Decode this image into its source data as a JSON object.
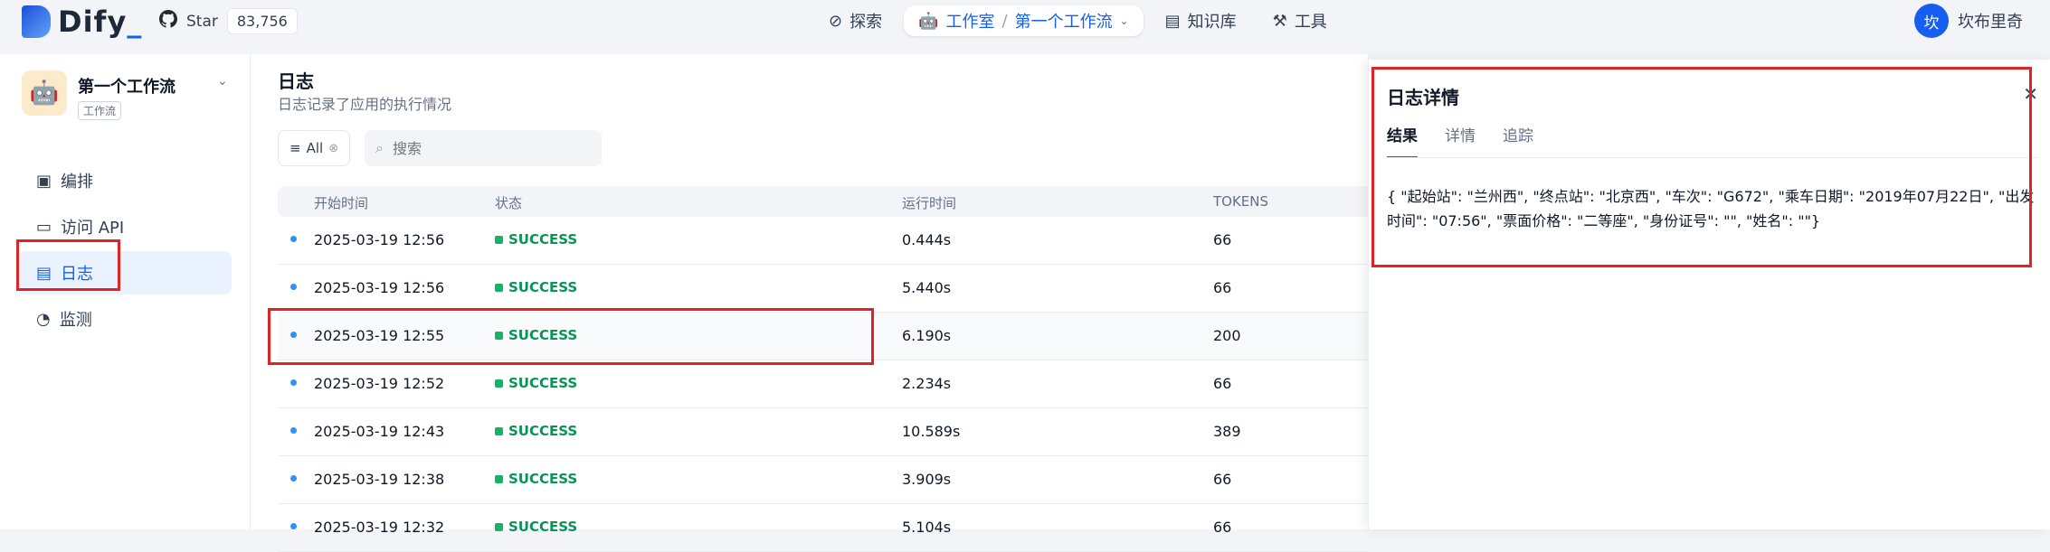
{
  "topbar": {
    "logo": "Dify",
    "logo_suffix": "_",
    "star_label": "Star",
    "star_count": "83,756",
    "nav": [
      {
        "label": "探索",
        "icon": "compass-icon"
      },
      {
        "label": "工作室",
        "icon": "robot-icon"
      },
      {
        "label": "知识库",
        "icon": "book-icon"
      },
      {
        "label": "工具",
        "icon": "hammer-icon"
      }
    ],
    "breadcrumb_app": "第一个工作流",
    "user_initial": "坎",
    "user_name": "坎布里奇"
  },
  "sidebar": {
    "app_name": "第一个工作流",
    "app_tag": "工作流",
    "items": [
      {
        "label": "编排",
        "icon": "layout-icon"
      },
      {
        "label": "访问 API",
        "icon": "terminal-icon"
      },
      {
        "label": "日志",
        "icon": "file-list-icon"
      },
      {
        "label": "监测",
        "icon": "gauge-icon"
      }
    ]
  },
  "main": {
    "title": "日志",
    "subtitle": "日志记录了应用的执行情况",
    "filter_label": "All",
    "search_placeholder": "搜索",
    "columns": [
      "开始时间",
      "状态",
      "运行时间",
      "TOKENS"
    ],
    "rows": [
      {
        "time": "2025-03-19 12:56",
        "status": "SUCCESS",
        "duration": "0.444s",
        "tokens": "66"
      },
      {
        "time": "2025-03-19 12:56",
        "status": "SUCCESS",
        "duration": "5.440s",
        "tokens": "66"
      },
      {
        "time": "2025-03-19 12:55",
        "status": "SUCCESS",
        "duration": "6.190s",
        "tokens": "200"
      },
      {
        "time": "2025-03-19 12:52",
        "status": "SUCCESS",
        "duration": "2.234s",
        "tokens": "66"
      },
      {
        "time": "2025-03-19 12:43",
        "status": "SUCCESS",
        "duration": "10.589s",
        "tokens": "389"
      },
      {
        "time": "2025-03-19 12:38",
        "status": "SUCCESS",
        "duration": "3.909s",
        "tokens": "66"
      },
      {
        "time": "2025-03-19 12:32",
        "status": "SUCCESS",
        "duration": "5.104s",
        "tokens": "66"
      }
    ]
  },
  "panel": {
    "title": "日志详情",
    "tabs": [
      "结果",
      "详情",
      "追踪"
    ],
    "result_text": "{ \"起始站\": \"兰州西\", \"终点站\": \"北京西\", \"车次\": \"G672\", \"乘车日期\": \"2019年07月22日\", \"出发时间\": \"07:56\", \"票面价格\": \"二等座\", \"身份证号\": \"\", \"姓名\": \"\"}"
  },
  "colors": {
    "accent": "#155eef",
    "success": "#079455",
    "highlight": "#e02424"
  }
}
